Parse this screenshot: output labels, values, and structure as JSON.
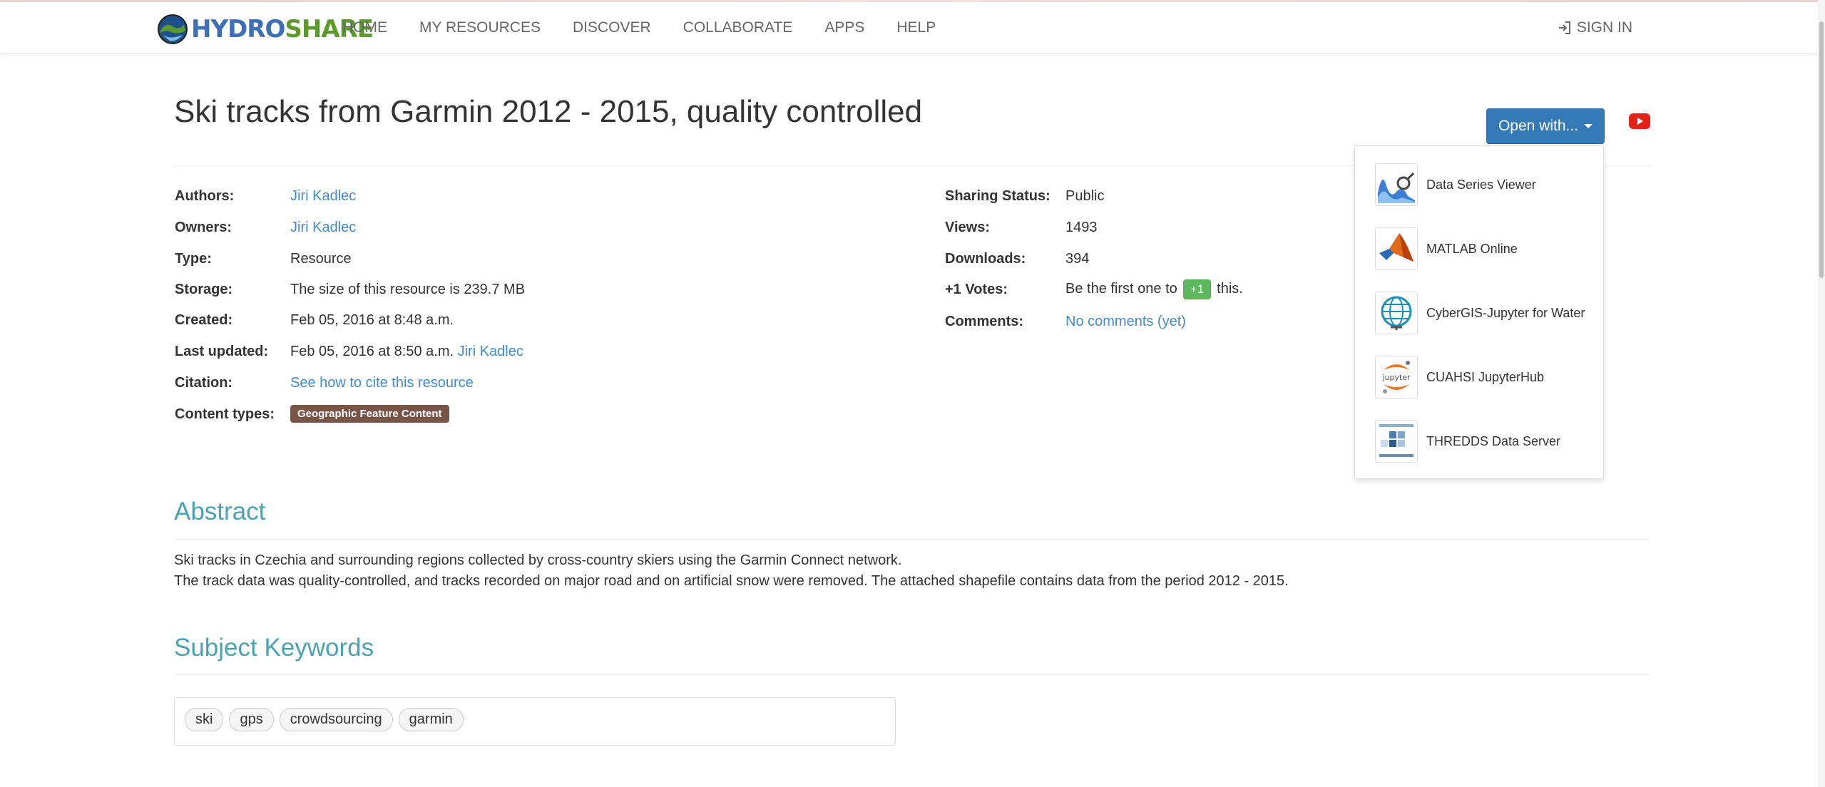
{
  "brand": {
    "hydro": "HYDRO",
    "share": "SHARE"
  },
  "nav": {
    "items": [
      "HOME",
      "MY RESOURCES",
      "DISCOVER",
      "COLLABORATE",
      "APPS",
      "HELP"
    ],
    "signin": "SIGN IN"
  },
  "resource": {
    "title": "Ski tracks from Garmin 2012 - 2015, quality controlled"
  },
  "open_with": {
    "label": "Open with...",
    "apps": [
      "Data Series Viewer",
      "MATLAB Online",
      "CyberGIS-Jupyter for Water",
      "CUAHSI JupyterHub",
      "THREDDS Data Server"
    ],
    "jupyter_text": "jupyter"
  },
  "meta_left": {
    "authors_key": "Authors:",
    "authors_val": "Jiri Kadlec",
    "owners_key": "Owners:",
    "owners_val": "Jiri Kadlec",
    "type_key": "Type:",
    "type_val": "Resource",
    "storage_key": "Storage:",
    "storage_val": "The size of this resource is 239.7 MB",
    "created_key": "Created:",
    "created_val": "Feb 05, 2016 at 8:48 a.m.",
    "updated_key": "Last updated:",
    "updated_val": "Feb 05, 2016 at 8:50 a.m.",
    "updated_by": "Jiri Kadlec",
    "citation_key": "Citation:",
    "citation_val": "See how to cite this resource",
    "content_key": "Content types:",
    "content_val": "Geographic Feature Content"
  },
  "meta_right": {
    "sharing_key": "Sharing Status:",
    "sharing_val": "Public",
    "views_key": "Views:",
    "views_val": "1493",
    "downloads_key": "Downloads:",
    "downloads_val": "394",
    "votes_key": "+1 Votes:",
    "votes_pre": "Be the first one to",
    "votes_btn": "+1",
    "votes_post": "this.",
    "comments_key": "Comments:",
    "comments_val": "No comments (yet)"
  },
  "abstract": {
    "heading": "Abstract",
    "line1": "Ski tracks in Czechia and surrounding regions collected by cross-country skiers using the Garmin Connect network.",
    "line2": "The track data was quality-controlled, and tracks recorded on major road and on artificial snow were removed. The attached shapefile contains data from the period 2012 - 2015."
  },
  "keywords": {
    "heading": "Subject Keywords",
    "items": [
      "ski",
      "gps",
      "crowdsourcing",
      "garmin"
    ]
  },
  "colors": {
    "accent": "#337ab7",
    "link": "#428bca",
    "heading": "#4aa3b2",
    "badge": "#795548",
    "vote": "#5cb85c"
  }
}
